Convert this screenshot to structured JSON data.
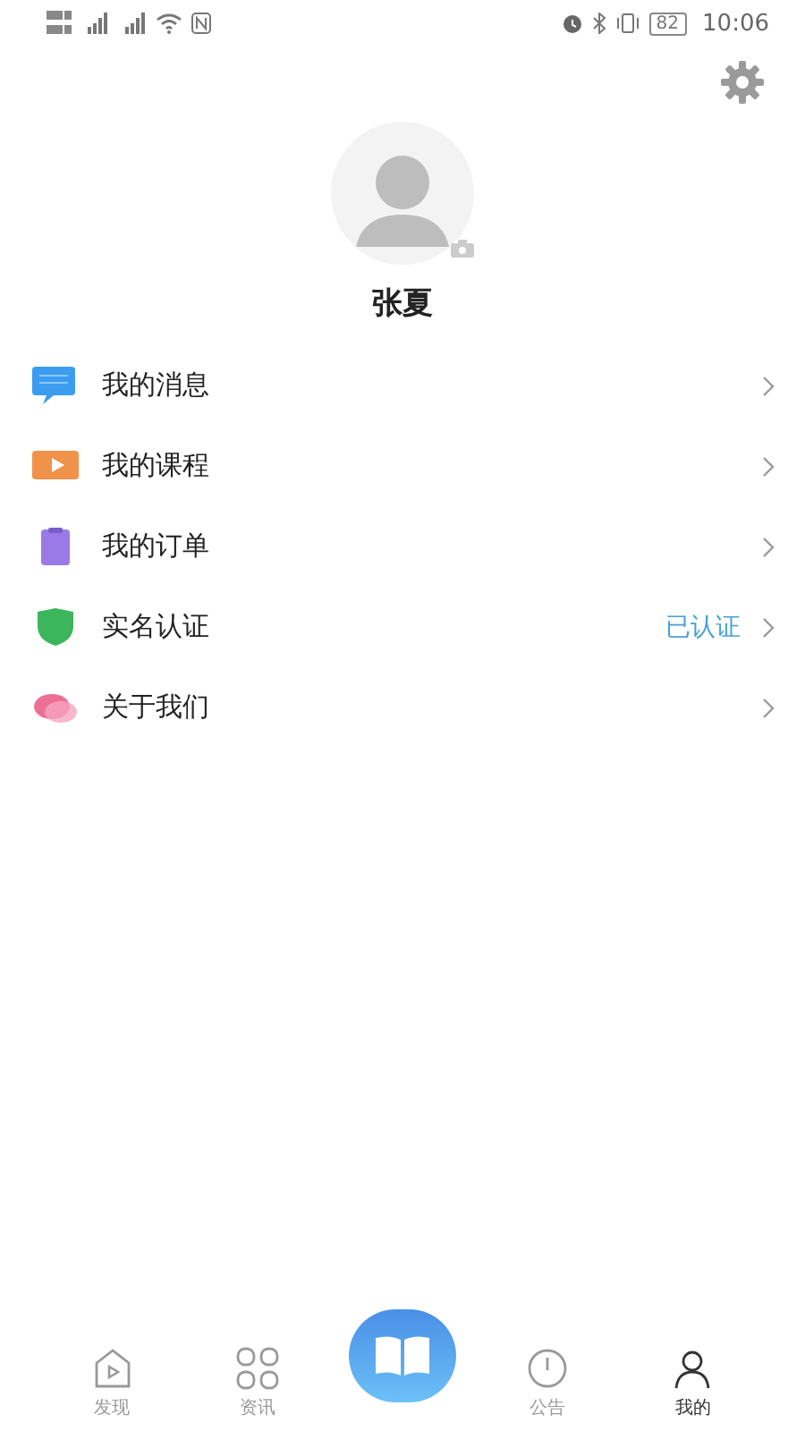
{
  "status_bar": {
    "battery": "82",
    "time": "10:06"
  },
  "profile": {
    "name": "张夏"
  },
  "menu": [
    {
      "kind": "message",
      "label": "我的消息"
    },
    {
      "kind": "course",
      "label": "我的课程"
    },
    {
      "kind": "order",
      "label": "我的订单"
    },
    {
      "kind": "verify",
      "label": "实名认证",
      "status": "已认证"
    },
    {
      "kind": "about",
      "label": "关于我们"
    }
  ],
  "nav": [
    {
      "kind": "discover",
      "label": "发现",
      "selected": false
    },
    {
      "kind": "news",
      "label": "资讯",
      "selected": false
    },
    {
      "kind": "book",
      "selected": false
    },
    {
      "kind": "notice",
      "label": "公告",
      "selected": false
    },
    {
      "kind": "mine",
      "label": "我的",
      "selected": true
    }
  ]
}
